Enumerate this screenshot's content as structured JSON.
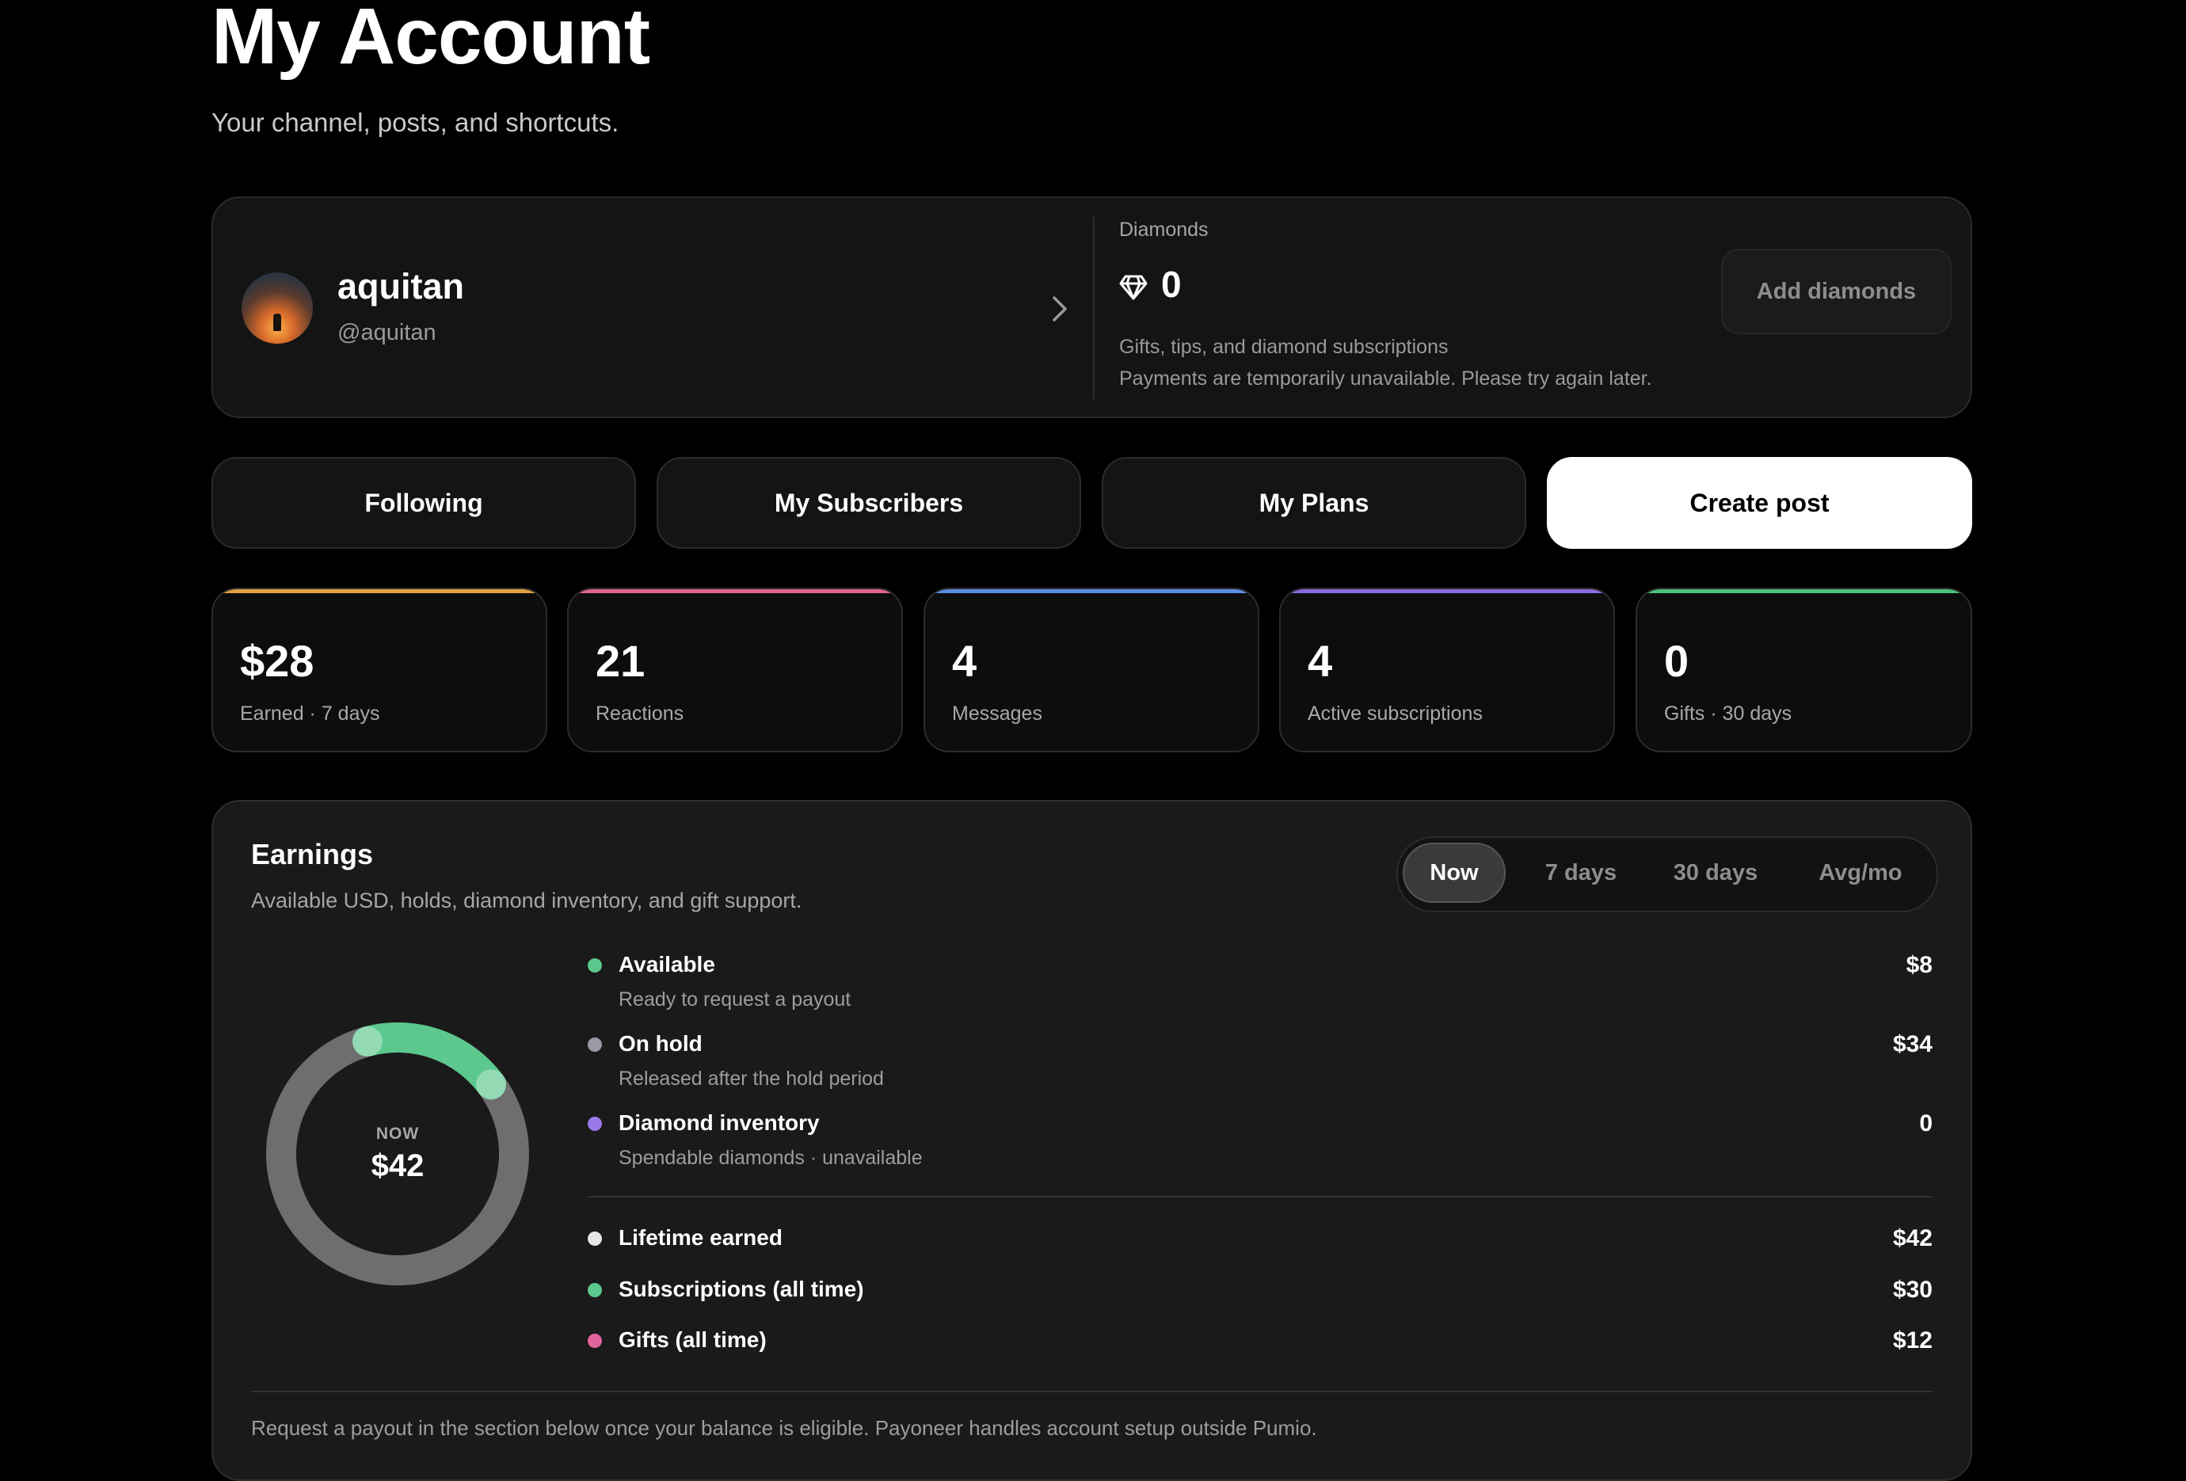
{
  "header": {
    "title": "My Account",
    "subtitle": "Your channel, posts, and shortcuts."
  },
  "profile": {
    "name": "aquitan",
    "handle": "@aquitan"
  },
  "diamonds": {
    "label": "Diamonds",
    "value": "0",
    "note1": "Gifts, tips, and diamond subscriptions",
    "note2": "Payments are temporarily unavailable. Please try again later.",
    "add_label": "Add diamonds"
  },
  "nav": {
    "following": "Following",
    "subscribers": "My Subscribers",
    "plans": "My Plans",
    "create": "Create post"
  },
  "stats": [
    {
      "value": "$28",
      "label": "Earned · 7 days",
      "color": "#e0a040"
    },
    {
      "value": "21",
      "label": "Reactions",
      "color": "#e0648c"
    },
    {
      "value": "4",
      "label": "Messages",
      "color": "#5a8ee0"
    },
    {
      "value": "4",
      "label": "Active subscriptions",
      "color": "#8a6ae0"
    },
    {
      "value": "0",
      "label": "Gifts · 30 days",
      "color": "#4cc080"
    }
  ],
  "earnings": {
    "title": "Earnings",
    "subtitle": "Available USD, holds, diamond inventory, and gift support.",
    "tabs": [
      "Now",
      "7 days",
      "30 days",
      "Avg/mo"
    ],
    "donut_label": "NOW",
    "donut_value": "$42",
    "donut_fraction": 0.19,
    "rows": [
      {
        "name": "Available",
        "desc": "Ready to request a payout",
        "value": "$8",
        "color": "#5cc88e"
      },
      {
        "name": "On hold",
        "desc": "Released after the hold period",
        "value": "$34",
        "color": "#9a9aa6"
      },
      {
        "name": "Diamond inventory",
        "desc": "Spendable diamonds · unavailable",
        "value": "0",
        "color": "#9a7ae8"
      }
    ],
    "totals": [
      {
        "name": "Lifetime earned",
        "value": "$42",
        "color": "#e6e6e6"
      },
      {
        "name": "Subscriptions (all time)",
        "value": "$30",
        "color": "#5cc88e"
      },
      {
        "name": "Gifts (all time)",
        "value": "$12",
        "color": "#e0649c"
      }
    ],
    "footer": "Request a payout in the section below once your balance is eligible. Payoneer handles account setup outside Pumio."
  }
}
